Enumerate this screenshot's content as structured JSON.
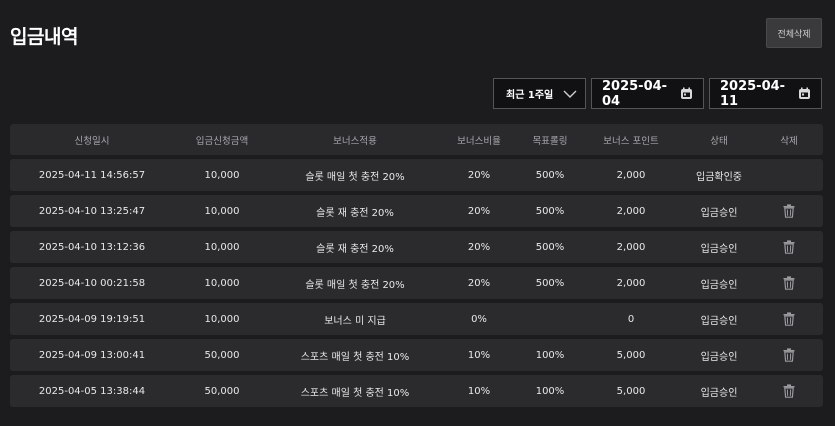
{
  "page": {
    "title": "입금내역",
    "delete_all_label": "전체삭제"
  },
  "filters": {
    "period_label": "최근 1주일",
    "start_date": "2025-04-04",
    "end_date": "2025-04-11"
  },
  "table": {
    "headers": [
      "신청일시",
      "입금신청금액",
      "보너스적용",
      "보너스비율",
      "목표롤링",
      "보너스 포인트",
      "상태",
      "삭제"
    ],
    "rows": [
      {
        "datetime": "2025-04-11 14:56:57",
        "amount": "10,000",
        "bonus": "슬롯 매일 첫 충전 20%",
        "rate": "20%",
        "rolling": "500%",
        "points": "2,000",
        "status": "입금확인중",
        "deletable": false
      },
      {
        "datetime": "2025-04-10 13:25:47",
        "amount": "10,000",
        "bonus": "슬롯 재 충전 20%",
        "rate": "20%",
        "rolling": "500%",
        "points": "2,000",
        "status": "입금승인",
        "deletable": true
      },
      {
        "datetime": "2025-04-10 13:12:36",
        "amount": "10,000",
        "bonus": "슬롯 재 충전 20%",
        "rate": "20%",
        "rolling": "500%",
        "points": "2,000",
        "status": "입금승인",
        "deletable": true
      },
      {
        "datetime": "2025-04-10 00:21:58",
        "amount": "10,000",
        "bonus": "슬롯 매일 첫 충전 20%",
        "rate": "20%",
        "rolling": "500%",
        "points": "2,000",
        "status": "입금승인",
        "deletable": true
      },
      {
        "datetime": "2025-04-09 19:19:51",
        "amount": "10,000",
        "bonus": "보너스 미 지급",
        "rate": "0%",
        "rolling": "",
        "points": "0",
        "status": "입금승인",
        "deletable": true
      },
      {
        "datetime": "2025-04-09 13:00:41",
        "amount": "50,000",
        "bonus": "스포츠 매일 첫 충전 10%",
        "rate": "10%",
        "rolling": "100%",
        "points": "5,000",
        "status": "입금승인",
        "deletable": true
      },
      {
        "datetime": "2025-04-05 13:38:44",
        "amount": "50,000",
        "bonus": "스포츠 매일 첫 충전 10%",
        "rate": "10%",
        "rolling": "100%",
        "points": "5,000",
        "status": "입금승인",
        "deletable": true
      }
    ]
  },
  "icons": {
    "chevron": "chevron-down-icon",
    "calendar": "calendar-icon",
    "trash": "trash-icon"
  }
}
